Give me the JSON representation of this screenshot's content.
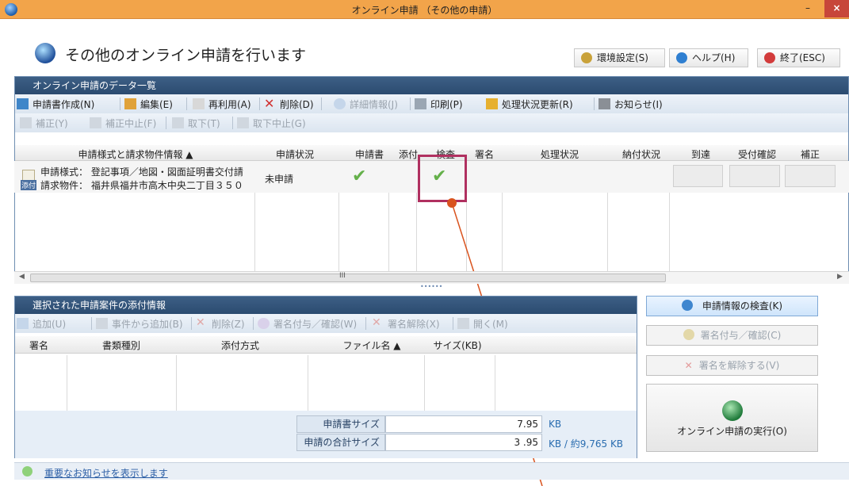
{
  "window": {
    "title": "オンライン申請 （その他の申請）",
    "min": "–",
    "max": "□",
    "close": "×"
  },
  "header": {
    "title": "その他のオンライン申請を行います",
    "settings": "環境設定(S)",
    "help": "ヘルプ(H)",
    "exit": "終了(ESC)"
  },
  "list_panel": {
    "title": "オンライン申請のデータ一覧",
    "toolbar1": [
      "申請書作成(N)",
      "編集(E)",
      "再利用(A)",
      "削除(D)",
      "詳細情報(J)",
      "印刷(P)",
      "処理状況更新(R)",
      "お知らせ(I)"
    ],
    "toolbar2": [
      "補正(Y)",
      "補正中止(F)",
      "取下(T)",
      "取下中止(G)"
    ],
    "columns": [
      "申請様式と請求物件情報 ▲",
      "申請状況",
      "申請書",
      "添付",
      "検査",
      "署名",
      "処理状況",
      "納付状況",
      "到達",
      "受付確認",
      "補正"
    ],
    "row": {
      "line1": "申請様式： 登記事項／地図・図面証明書交付請",
      "line2": "請求物件： 福井県福井市高木中央二丁目３５０",
      "badge": "添付",
      "status": "未申請"
    },
    "scroll_mark": "III",
    "splitter": "••••••"
  },
  "attach_panel": {
    "title": "選択された申請案件の添付情報",
    "toolbar": [
      "追加(U)",
      "事件から追加(B)",
      "削除(Z)",
      "署名付与／確認(W)",
      "署名解除(X)",
      "開く(M)"
    ],
    "columns": [
      "署名",
      "書類種別",
      "添付方式",
      "ファイル名 ▲",
      "サイズ(KB)"
    ],
    "doc_size_label": "申請書サイズ",
    "doc_size_value": "7.95",
    "doc_size_unit": "KB",
    "total_label": "申請の合計サイズ",
    "total_value": "3  .95",
    "total_unit": "KB / 約9,765 KB"
  },
  "right_buttons": {
    "inspect": "申請情報の検査(K)",
    "sign": "署名付与／確認(C)",
    "unsign": "署名を解除する(V)",
    "execute": "オンライン申請の実行(O)"
  },
  "status": {
    "notice": "重要なお知らせを表示します"
  },
  "colors": {
    "titlebar": "#f2a44a",
    "panel_head": "#2f5077",
    "check": "#64b04a",
    "callout": "#b03060",
    "close": "#c7463a"
  }
}
